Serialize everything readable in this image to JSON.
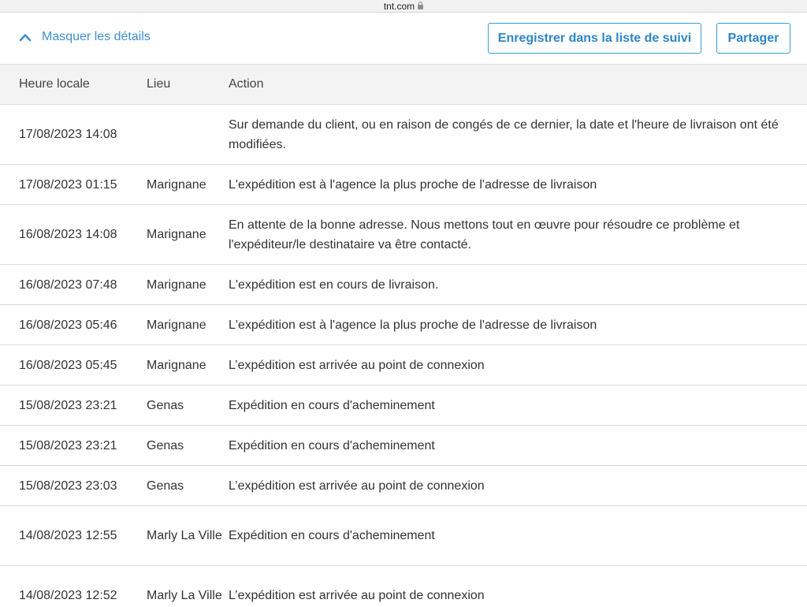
{
  "browser": {
    "url": "tnt.com"
  },
  "toolbar": {
    "toggle_label": "Masquer les détails",
    "watch_button": "Enregistrer dans la liste de suivi",
    "share_button": "Partager"
  },
  "table": {
    "headers": [
      "Heure locale",
      "Lieu",
      "Action"
    ],
    "rows": [
      {
        "time": "17/08/2023 14:08",
        "place": "",
        "action": "Sur demande du client, ou en raison de congés de ce dernier, la date et l'heure de livraison ont été modifiées."
      },
      {
        "time": "17/08/2023 01:15",
        "place": "Marignane",
        "action": "L'expédition est à l'agence la plus proche de l'adresse de livraison"
      },
      {
        "time": "16/08/2023 14:08",
        "place": "Marignane",
        "action": "En attente de la bonne adresse. Nous mettons tout en œuvre pour résoudre ce problème et l'expéditeur/le destinataire va être contacté."
      },
      {
        "time": "16/08/2023 07:48",
        "place": "Marignane",
        "action": "L'expédition est en cours de livraison."
      },
      {
        "time": "16/08/2023 05:46",
        "place": "Marignane",
        "action": "L'expédition est à l'agence la plus proche de l'adresse de livraison"
      },
      {
        "time": "16/08/2023 05:45",
        "place": "Marignane",
        "action": "L’expédition est arrivée au point de connexion"
      },
      {
        "time": "15/08/2023 23:21",
        "place": "Genas",
        "action": "Expédition en cours d'acheminement"
      },
      {
        "time": "15/08/2023 23:21",
        "place": "Genas",
        "action": "Expédition en cours d'acheminement"
      },
      {
        "time": "15/08/2023 23:03",
        "place": "Genas",
        "action": "L’expédition est arrivée au point de connexion"
      },
      {
        "time": "14/08/2023 12:55",
        "place": "Marly La Ville",
        "action": "Expédition en cours d'acheminement"
      },
      {
        "time": "14/08/2023 12:52",
        "place": "Marly La Ville",
        "action": "L’expédition est arrivée au point de connexion"
      }
    ]
  },
  "colors": {
    "accent": "#3f8fcf",
    "border": "#dcdcdc",
    "header_bg": "#f3f3f3"
  },
  "icons": {
    "toggle": "chevron-up-icon",
    "secure": "lock-icon"
  }
}
